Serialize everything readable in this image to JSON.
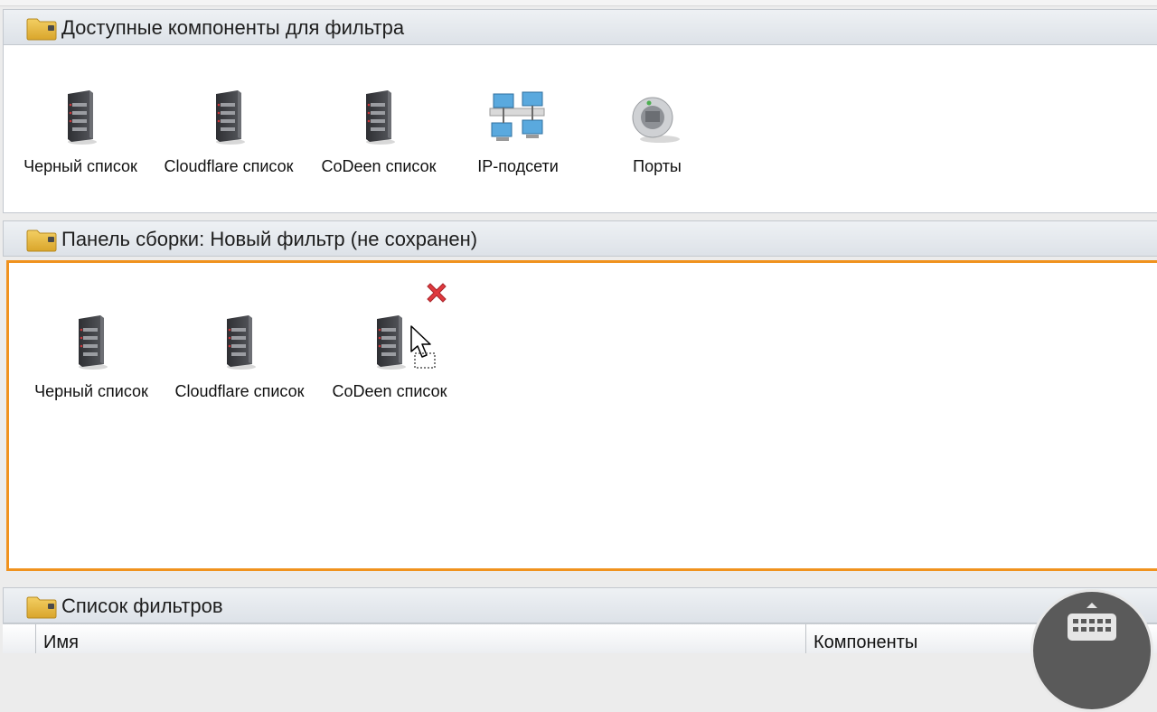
{
  "available_panel": {
    "title": "Доступные компоненты для фильтра",
    "items": [
      {
        "label": "Черный список",
        "icon": "server-list-icon"
      },
      {
        "label": "Cloudflare список",
        "icon": "server-list-icon"
      },
      {
        "label": "CoDeen список",
        "icon": "server-list-icon"
      },
      {
        "label": "IP-подсети",
        "icon": "network-icon"
      },
      {
        "label": "Порты",
        "icon": "port-icon"
      }
    ]
  },
  "build_panel": {
    "title": "Панель сборки: Новый фильтр (не сохранен)",
    "items": [
      {
        "label": "Черный список",
        "icon": "server-list-icon"
      },
      {
        "label": "Cloudflare список",
        "icon": "server-list-icon"
      },
      {
        "label": "CoDeen список",
        "icon": "server-list-icon"
      }
    ],
    "accent_color": "#f0921e"
  },
  "filters_panel": {
    "title": "Список фильтров",
    "columns": [
      "Имя",
      "Компоненты"
    ]
  }
}
